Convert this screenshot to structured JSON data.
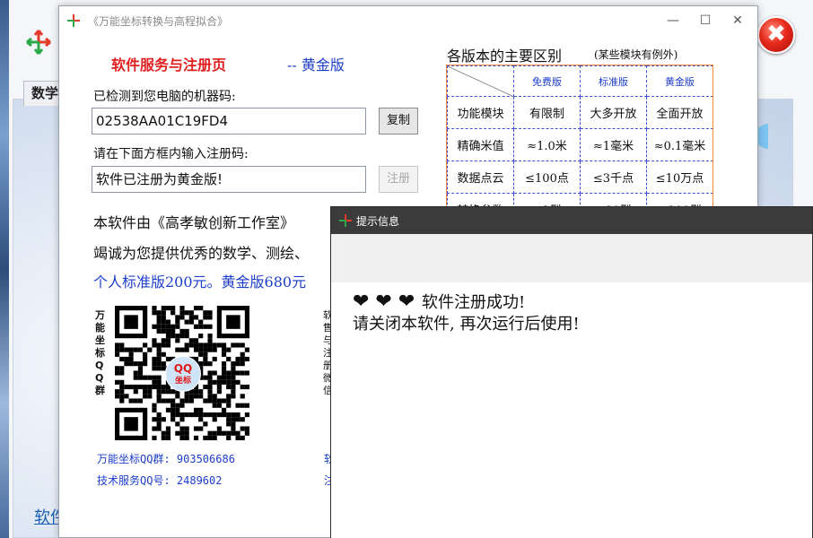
{
  "bg_app": {
    "tab_label": "数学",
    "bottom_text": "软件",
    "close_glyph": "✖"
  },
  "reg_window": {
    "title": "《万能坐标转换与高程拟合》",
    "minimize": "—",
    "maximize": "☐",
    "close": "✕",
    "header_red": "软件服务与注册页",
    "header_blue": "-- 黄金版",
    "machine_code_label": "已检测到您电脑的机器码:",
    "machine_code_value": "02538AA01C19FD4",
    "copy_button": "复制",
    "reg_code_label": "请在下面方框内输入注册码:",
    "reg_code_value": "软件已注册为黄金版!",
    "register_button": "注册",
    "para1": "本软件由《高孝敏创新工作室》",
    "para2": "竭诚为您提供优秀的数学、测绘、",
    "para3": "个人标准版200元。黄金版680元",
    "qr_label_left": "万能坐标QQ群",
    "qr_label_right": "软售与注册微信",
    "qr_badge_top": "QQ",
    "qr_badge_bottom": "坐标",
    "qq_group": "万能坐标QQ群: 903506686",
    "qq_service": "技术服务QQ号: 2489602",
    "right_line1": "软",
    "right_line2": "注"
  },
  "comparison": {
    "title": "各版本的主要区别",
    "note": "(某些模块有例外)",
    "columns": [
      "免费版",
      "标准版",
      "黄金版"
    ],
    "rows": [
      {
        "label": "功能模块",
        "cells": [
          "有限制",
          "大多开放",
          "全面开放"
        ]
      },
      {
        "label": "精确米值",
        "cells": [
          "≈1.0米",
          "≈1毫米",
          "≈0.1毫米"
        ]
      },
      {
        "label": "数据点云",
        "cells": [
          "≤100点",
          "≤3千点",
          "≤10万点"
        ]
      },
      {
        "label": "转换参数",
        "cells": [
          "≤3型",
          "≤80型",
          "≤200型"
        ]
      }
    ]
  },
  "dialog": {
    "title": "提示信息",
    "hearts": "❤ ❤ ❤",
    "message_line1": "软件注册成功!",
    "message_line2": "请关闭本软件, 再次运行后使用!"
  }
}
